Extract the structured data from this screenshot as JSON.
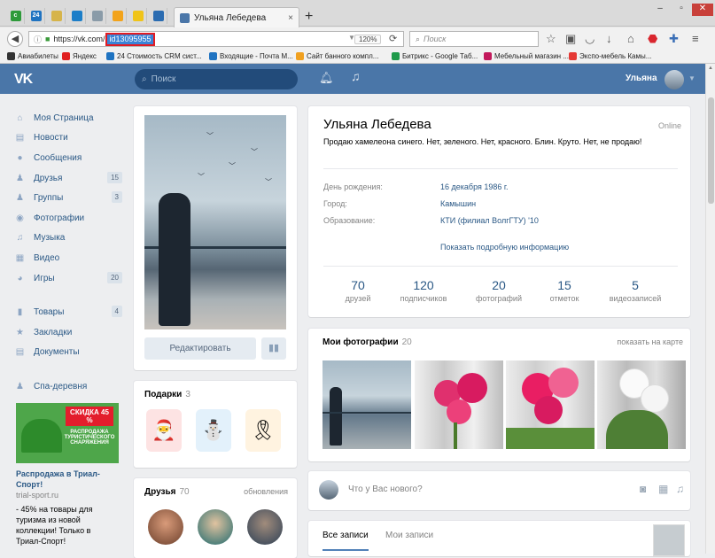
{
  "browser": {
    "active_tab_title": "Ульяна Лебедева",
    "close_glyph": "×",
    "new_tab_glyph": "+",
    "pinned_tabs": [
      {
        "label": "c",
        "color": "#2e9a3a"
      },
      {
        "label": "24",
        "color": "#1f73c1"
      },
      {
        "label": "",
        "color": "#d6b44a"
      },
      {
        "label": "",
        "color": "#1c7ec8"
      },
      {
        "label": "",
        "color": "#8a9ba8"
      },
      {
        "label": "",
        "color": "#f2a31b"
      },
      {
        "label": "",
        "color": "#f0c419"
      },
      {
        "label": "",
        "color": "#2b6cb1"
      }
    ],
    "window_buttons": {
      "minimize": "‒",
      "maximize": "▫",
      "close": "✕"
    },
    "url_prefix": "https://vk.com/",
    "url_highlight": "id13095955",
    "zoom": "120%",
    "search_placeholder": "Поиск",
    "bookmarks": [
      {
        "label": "Авиабилеты",
        "color": "#333333"
      },
      {
        "label": "Яндекс",
        "color": "#e01f1f"
      },
      {
        "label": "24 Стоимость CRM сист...",
        "color": "#1f73c1"
      },
      {
        "label": "Входящие - Почта М...",
        "color": "#1f73c1"
      },
      {
        "label": "Сайт банного компл...",
        "color": "#f0a020"
      },
      {
        "label": "Битрикс - Google Таб...",
        "color": "#1f9a4a"
      },
      {
        "label": "Мебельный магазин ...",
        "color": "#c2185b"
      },
      {
        "label": "Экспо-мебель Камы...",
        "color": "#e53935"
      }
    ]
  },
  "vk": {
    "logo": "VK",
    "search_placeholder": "Поиск",
    "user_name": "Ульяна"
  },
  "left_nav": [
    {
      "icon": "home-icon",
      "glyph": "⌂",
      "label": "Моя Страница",
      "count": ""
    },
    {
      "icon": "news-icon",
      "glyph": "▤",
      "label": "Новости",
      "count": ""
    },
    {
      "icon": "messages-icon",
      "glyph": "●",
      "label": "Сообщения",
      "count": ""
    },
    {
      "icon": "friends-icon",
      "glyph": "♟",
      "label": "Друзья",
      "count": "15"
    },
    {
      "icon": "groups-icon",
      "glyph": "♟",
      "label": "Группы",
      "count": "3"
    },
    {
      "icon": "photos-icon",
      "glyph": "◉",
      "label": "Фотографии",
      "count": ""
    },
    {
      "icon": "music-icon",
      "glyph": "♫",
      "label": "Музыка",
      "count": ""
    },
    {
      "icon": "video-icon",
      "glyph": "▦",
      "label": "Видео",
      "count": ""
    },
    {
      "icon": "games-icon",
      "glyph": "◕",
      "label": "Игры",
      "count": "20"
    },
    {
      "gap": true
    },
    {
      "icon": "goods-icon",
      "glyph": "▮",
      "label": "Товары",
      "count": "4"
    },
    {
      "icon": "bookmarks-icon",
      "glyph": "★",
      "label": "Закладки",
      "count": ""
    },
    {
      "icon": "documents-icon",
      "glyph": "▤",
      "label": "Документы",
      "count": ""
    },
    {
      "gap": true
    },
    {
      "icon": "group-icon",
      "glyph": "♟",
      "label": "Спа-деревня",
      "count": ""
    }
  ],
  "ad": {
    "sale": "СКИДКА 45 %",
    "text": "РАСПРОДАЖА ТУРИСТИЧЕСКОГО СНАРЯЖЕНИЯ",
    "title": "Распродажа в Триал-Спорт!",
    "site": "trial-sport.ru",
    "body": "- 45% на товары для туризма из новой коллекции! Только в Триал-Спорт!"
  },
  "profile": {
    "name": "Ульяна Лебедева",
    "online": "Online",
    "status": "Продаю хамелеона синего. Нет, зеленого. Нет, красного. Блин. Круто. Нет, не продаю!",
    "info": [
      {
        "label": "День рождения:",
        "value": "16 декабря 1986 г."
      },
      {
        "label": "Город:",
        "value": "Камышин"
      },
      {
        "label": "Образование:",
        "value": "КТИ (филиал ВолгГТУ) '10"
      }
    ],
    "more": "Показать подробную информацию",
    "counters": [
      {
        "n": "70",
        "label": "друзей"
      },
      {
        "n": "120",
        "label": "подписчиков"
      },
      {
        "n": "20",
        "label": "фотографий"
      },
      {
        "n": "15",
        "label": "отметок"
      },
      {
        "n": "5",
        "label": "видеозаписей"
      }
    ],
    "edit_button": "Редактировать"
  },
  "gifts": {
    "title": "Подарки",
    "count": "3",
    "items": [
      "🎅",
      "⛄",
      "🎗"
    ]
  },
  "friends": {
    "title": "Друзья",
    "count": "70",
    "updates": "обновления"
  },
  "photos": {
    "title": "Мои фотографии",
    "count": "20",
    "map_link": "показать на карте"
  },
  "post_box": {
    "placeholder": "Что у Вас нового?"
  },
  "wall": {
    "tab_all": "Все записи",
    "tab_mine": "Мои записи"
  }
}
